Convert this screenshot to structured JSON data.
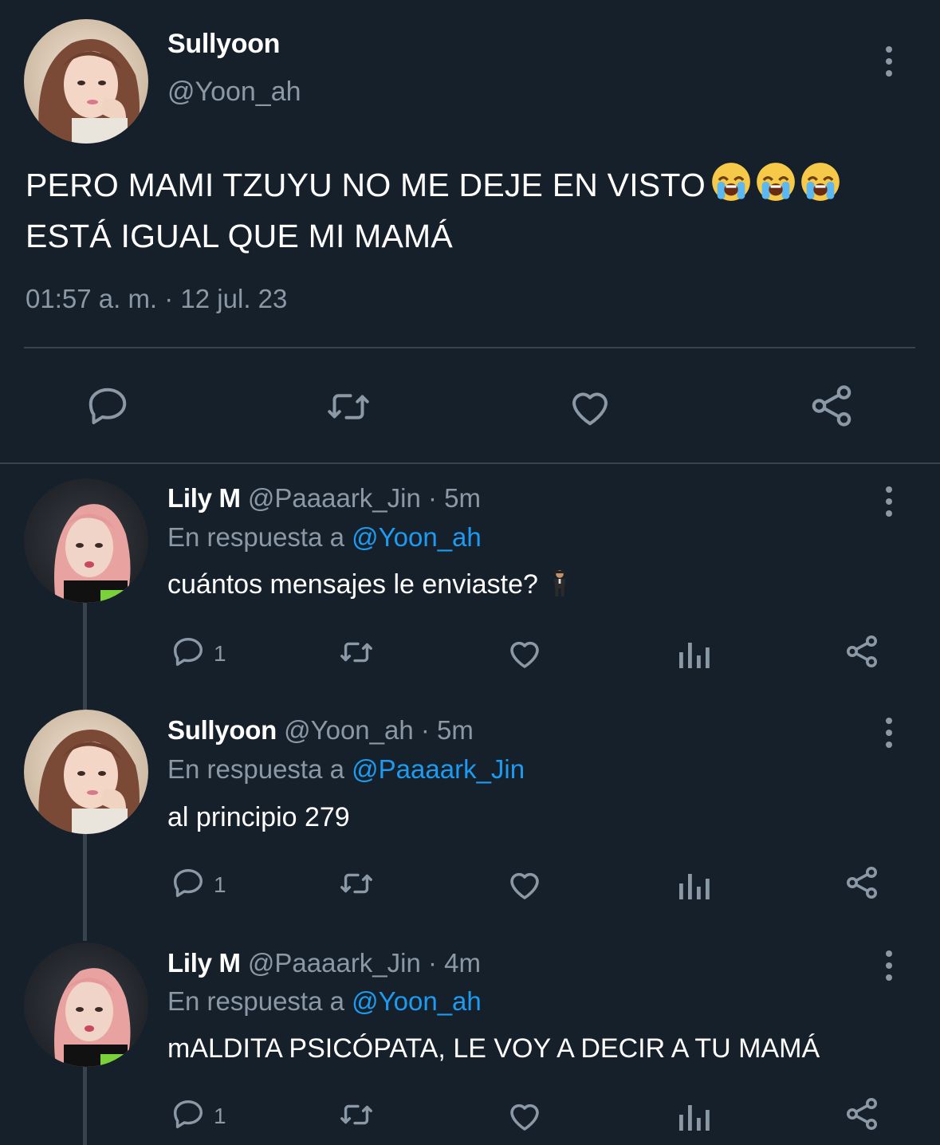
{
  "main_tweet": {
    "name": "Sullyoon",
    "handle": "@Yoon_ah",
    "text_line1": "PERO MAMI TZUYU NO ME DEJE EN VISTO",
    "text_emojis": [
      "loudly-crying-face",
      "loudly-crying-face",
      "loudly-crying-face"
    ],
    "text_line2": "ESTÁ IGUAL QUE MI MAMÁ",
    "timestamp": "01:57 a. m. · 12 jul. 23",
    "actions": [
      "reply-icon",
      "retweet-icon",
      "like-icon",
      "share-icon"
    ]
  },
  "replies": [
    {
      "name": "Lily M",
      "meta": "@Paaaark_Jin · 5m",
      "in_reply_prefix": "En respuesta a ",
      "in_reply_mention": "@Yoon_ah",
      "text": "cuántos mensajes le enviaste?",
      "emoji": "man-in-business-suit-levitating",
      "reply_count": "1"
    },
    {
      "name": "Sullyoon",
      "meta": "@Yoon_ah · 5m",
      "in_reply_prefix": "En respuesta a ",
      "in_reply_mention": "@Paaaark_Jin",
      "text": "al principio 279",
      "reply_count": "1"
    },
    {
      "name": "Lily M",
      "meta": "@Paaaark_Jin · 4m",
      "in_reply_prefix": "En respuesta a ",
      "in_reply_mention": "@Yoon_ah",
      "text": "mALDITA PSICÓPATA, LE VOY A DECIR A TU MAMÁ",
      "reply_count": "1"
    }
  ],
  "colors": {
    "background": "#15202b",
    "text_primary": "#ffffff",
    "text_secondary": "#8b98a5",
    "link": "#1d9bf0",
    "divider": "#38444d"
  }
}
